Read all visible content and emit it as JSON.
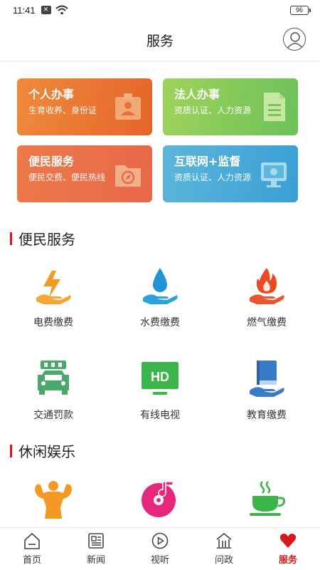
{
  "status": {
    "time": "11:41",
    "battery": "96"
  },
  "header": {
    "title": "服务"
  },
  "cards": [
    {
      "title": "个人办事",
      "subtitle": "生育收养、身份证"
    },
    {
      "title": "法人办事",
      "subtitle": "资质认证、人力资源"
    },
    {
      "title": "便民服务",
      "subtitle": "便民交费、便民热线"
    },
    {
      "title": "互联网+监督",
      "subtitle": "资质认证、人力资源"
    }
  ],
  "sections": [
    {
      "title": "便民服务",
      "items": [
        {
          "label": "电费缴费",
          "icon": "electricity-icon"
        },
        {
          "label": "水费缴费",
          "icon": "water-drop-icon"
        },
        {
          "label": "燃气缴费",
          "icon": "gas-flame-icon"
        },
        {
          "label": "交通罚款",
          "icon": "car-icon"
        },
        {
          "label": "有线电视",
          "icon": "hd-tv-icon"
        },
        {
          "label": "教育缴费",
          "icon": "book-icon"
        }
      ]
    },
    {
      "title": "休闲娱乐",
      "items": [
        {
          "label": "",
          "icon": "fitness-icon"
        },
        {
          "label": "",
          "icon": "music-disc-icon"
        },
        {
          "label": "",
          "icon": "tea-cup-icon"
        }
      ]
    }
  ],
  "nav": [
    {
      "label": "首页",
      "icon": "home-icon"
    },
    {
      "label": "新闻",
      "icon": "news-icon"
    },
    {
      "label": "视听",
      "icon": "play-icon"
    },
    {
      "label": "问政",
      "icon": "government-icon"
    },
    {
      "label": "服务",
      "icon": "heart-icon",
      "active": true
    }
  ],
  "colors": {
    "accent": "#d7191f"
  }
}
